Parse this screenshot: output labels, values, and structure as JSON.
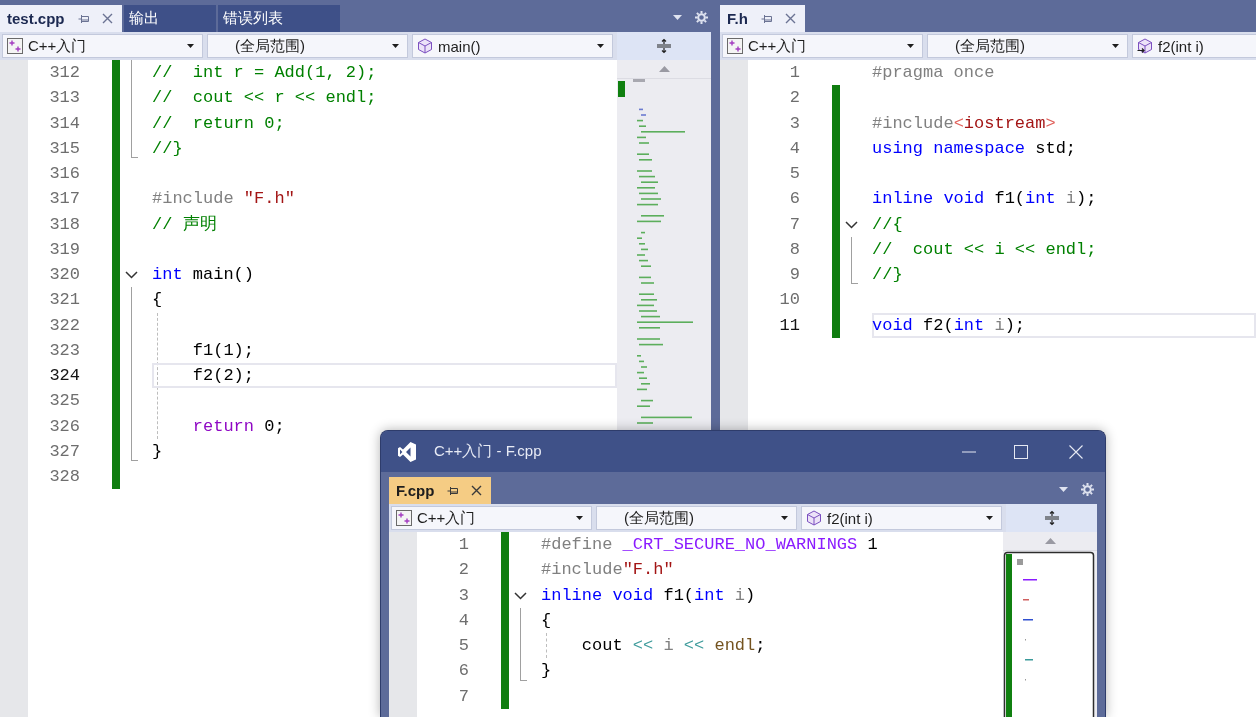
{
  "panes": [
    {
      "focused": false,
      "cut_off": false,
      "tabs": [
        {
          "label": "test.cpp",
          "selected": true
        },
        {
          "label": "输出",
          "selected": false
        },
        {
          "label": "错误列表",
          "selected": false
        }
      ],
      "nav": [
        {
          "kind": "project",
          "text": "C++入门"
        },
        {
          "kind": "scope",
          "text": "(全局范围)"
        },
        {
          "kind": "function",
          "text": "main()"
        }
      ],
      "lines": [
        {
          "children": [
            {
              "n": "312",
              "changed": true,
              "current": false,
              "code": [
                {
                  "kind": "comment",
                  "text": "//  int r = Add(1, 2);"
                }
              ]
            },
            {
              "n": "313",
              "changed": true,
              "current": false,
              "code": [
                {
                  "kind": "comment",
                  "text": "//  cout << r << endl;"
                }
              ]
            },
            {
              "n": "314",
              "changed": true,
              "current": false,
              "code": [
                {
                  "kind": "comment",
                  "text": "//  return 0;"
                }
              ]
            },
            {
              "n": "315",
              "changed": true,
              "current": false,
              "code": [
                {
                  "kind": "comment",
                  "text": "//}"
                }
              ]
            }
          ]
        },
        {
          "n": "316",
          "changed": true,
          "current": false
        },
        {
          "n": "317",
          "changed": true,
          "current": false,
          "code": [
            {
              "kind": "preproc",
              "text": "#include"
            },
            {
              "kind": "string",
              "text": " \"F.h\""
            }
          ]
        },
        {
          "n": "318",
          "changed": true,
          "current": false,
          "code": [
            {
              "kind": "comment",
              "text": "// 声明"
            }
          ]
        },
        {
          "n": "319",
          "changed": true,
          "current": false
        },
        {
          "n": "320",
          "changed": true,
          "current": false,
          "expanded": true,
          "code": [
            {
              "kind": "keyword",
              "text": "int"
            },
            {
              "kind": "plain",
              "text": " main()"
            }
          ],
          "children": [
            {
              "n": "321",
              "changed": true,
              "current": false,
              "code": [
                {
                  "kind": "plain",
                  "text": "{"
                }
              ]
            },
            {
              "n": "322",
              "changed": true,
              "current": false
            },
            {
              "n": "323",
              "changed": true,
              "current": false,
              "code": [
                {
                  "kind": "plain",
                  "text": "    f1(1);"
                }
              ]
            },
            {
              "n": "324",
              "changed": true,
              "current": true,
              "code": [
                {
                  "kind": "plain",
                  "text": "    f2(2);"
                }
              ]
            },
            {
              "n": "325",
              "changed": true,
              "current": false
            },
            {
              "n": "326",
              "changed": true,
              "current": false,
              "code": [
                {
                  "kind": "control",
                  "text": "    return"
                },
                {
                  "kind": "plain",
                  "text": " 0;"
                }
              ]
            },
            {
              "n": "327",
              "changed": true,
              "current": false,
              "code": [
                {
                  "kind": "plain",
                  "text": "}"
                }
              ]
            }
          ]
        },
        {
          "n": "328",
          "changed": true,
          "current": false
        }
      ]
    },
    {
      "focused": false,
      "cut_off": true,
      "tabs": [
        {
          "label": "F.h",
          "selected": true
        }
      ],
      "nav": [
        {
          "kind": "project",
          "text": "C++入门"
        },
        {
          "kind": "scope",
          "text": "(全局范围)"
        },
        {
          "kind": "prototype",
          "text": "f2(int i)"
        }
      ],
      "lines": [
        {
          "n": "1",
          "changed": false,
          "current": false,
          "code": [
            {
              "kind": "preproc",
              "text": "#pragma once"
            }
          ]
        },
        {
          "n": "2",
          "changed": true,
          "current": false
        },
        {
          "n": "3",
          "changed": true,
          "current": false,
          "code": [
            {
              "kind": "preproc",
              "text": "#include"
            },
            {
              "kind": "bracket",
              "text": "<"
            },
            {
              "kind": "string",
              "text": "iostream"
            },
            {
              "kind": "bracket",
              "text": ">"
            }
          ]
        },
        {
          "n": "4",
          "changed": true,
          "current": false,
          "code": [
            {
              "kind": "keyword",
              "text": "using"
            },
            {
              "kind": "keyword",
              "text": " namespace"
            },
            {
              "kind": "plain",
              "text": " std;"
            }
          ]
        },
        {
          "n": "5",
          "changed": true,
          "current": false
        },
        {
          "n": "6",
          "changed": true,
          "current": false,
          "code": [
            {
              "kind": "keyword",
              "text": "inline"
            },
            {
              "kind": "keyword",
              "text": " void"
            },
            {
              "kind": "plain",
              "text": " f1("
            },
            {
              "kind": "keyword",
              "text": "int"
            },
            {
              "kind": "param",
              "text": " i"
            },
            {
              "kind": "plain",
              "text": ");"
            }
          ]
        },
        {
          "n": "7",
          "changed": true,
          "current": false,
          "expanded": true,
          "code": [
            {
              "kind": "comment",
              "text": "//{"
            }
          ],
          "children": [
            {
              "n": "8",
              "changed": true,
              "current": false,
              "code": [
                {
                  "kind": "comment",
                  "text": "//  cout << i << endl;"
                }
              ]
            },
            {
              "n": "9",
              "changed": true,
              "current": false,
              "code": [
                {
                  "kind": "comment",
                  "text": "//}"
                }
              ]
            }
          ]
        },
        {
          "n": "10",
          "changed": true,
          "current": false
        },
        {
          "n": "11",
          "changed": true,
          "current": true,
          "code": [
            {
              "kind": "keyword",
              "text": "void"
            },
            {
              "kind": "plain",
              "text": " f2("
            },
            {
              "kind": "keyword",
              "text": "int"
            },
            {
              "kind": "param",
              "text": " i"
            },
            {
              "kind": "plain",
              "text": ");"
            }
          ]
        }
      ]
    }
  ],
  "floating_window": {
    "title": "C++入门 - F.cpp",
    "focused": true,
    "cut_off": false,
    "tabs": [
      {
        "label": "F.cpp",
        "selected": true
      }
    ],
    "nav": [
      {
        "kind": "project",
        "text": "C++入门"
      },
      {
        "kind": "scope",
        "text": "(全局范围)"
      },
      {
        "kind": "function",
        "text": "f2(int i)"
      }
    ],
    "lines": [
      {
        "n": "1",
        "changed": true,
        "current": false,
        "code": [
          {
            "kind": "preproc",
            "text": "#define"
          },
          {
            "kind": "macro",
            "text": " _CRT_SECURE_NO_WARNINGS"
          },
          {
            "kind": "plain",
            "text": " 1"
          }
        ]
      },
      {
        "n": "2",
        "changed": true,
        "current": false,
        "code": [
          {
            "kind": "preproc",
            "text": "#include"
          },
          {
            "kind": "string",
            "text": "\"F.h\""
          }
        ]
      },
      {
        "n": "3",
        "changed": true,
        "current": false,
        "expanded": true,
        "code": [
          {
            "kind": "keyword",
            "text": "inline"
          },
          {
            "kind": "keyword",
            "text": " void"
          },
          {
            "kind": "plain",
            "text": " f1("
          },
          {
            "kind": "keyword",
            "text": "int"
          },
          {
            "kind": "param",
            "text": " i"
          },
          {
            "kind": "plain",
            "text": ")"
          }
        ],
        "children": [
          {
            "n": "4",
            "changed": true,
            "current": false,
            "code": [
              {
                "kind": "plain",
                "text": "{"
              }
            ]
          },
          {
            "n": "5",
            "changed": true,
            "current": false,
            "code": [
              {
                "kind": "plain",
                "text": "    cout "
              },
              {
                "kind": "operator",
                "text": "<<"
              },
              {
                "kind": "param",
                "text": " i"
              },
              {
                "kind": "operator",
                "text": " <<"
              },
              {
                "kind": "function",
                "text": " endl"
              },
              {
                "kind": "plain",
                "text": ";"
              }
            ]
          },
          {
            "n": "6",
            "changed": true,
            "current": false,
            "code": [
              {
                "kind": "plain",
                "text": "}"
              }
            ]
          }
        ]
      },
      {
        "n": "7",
        "changed": true,
        "current": false
      }
    ]
  }
}
